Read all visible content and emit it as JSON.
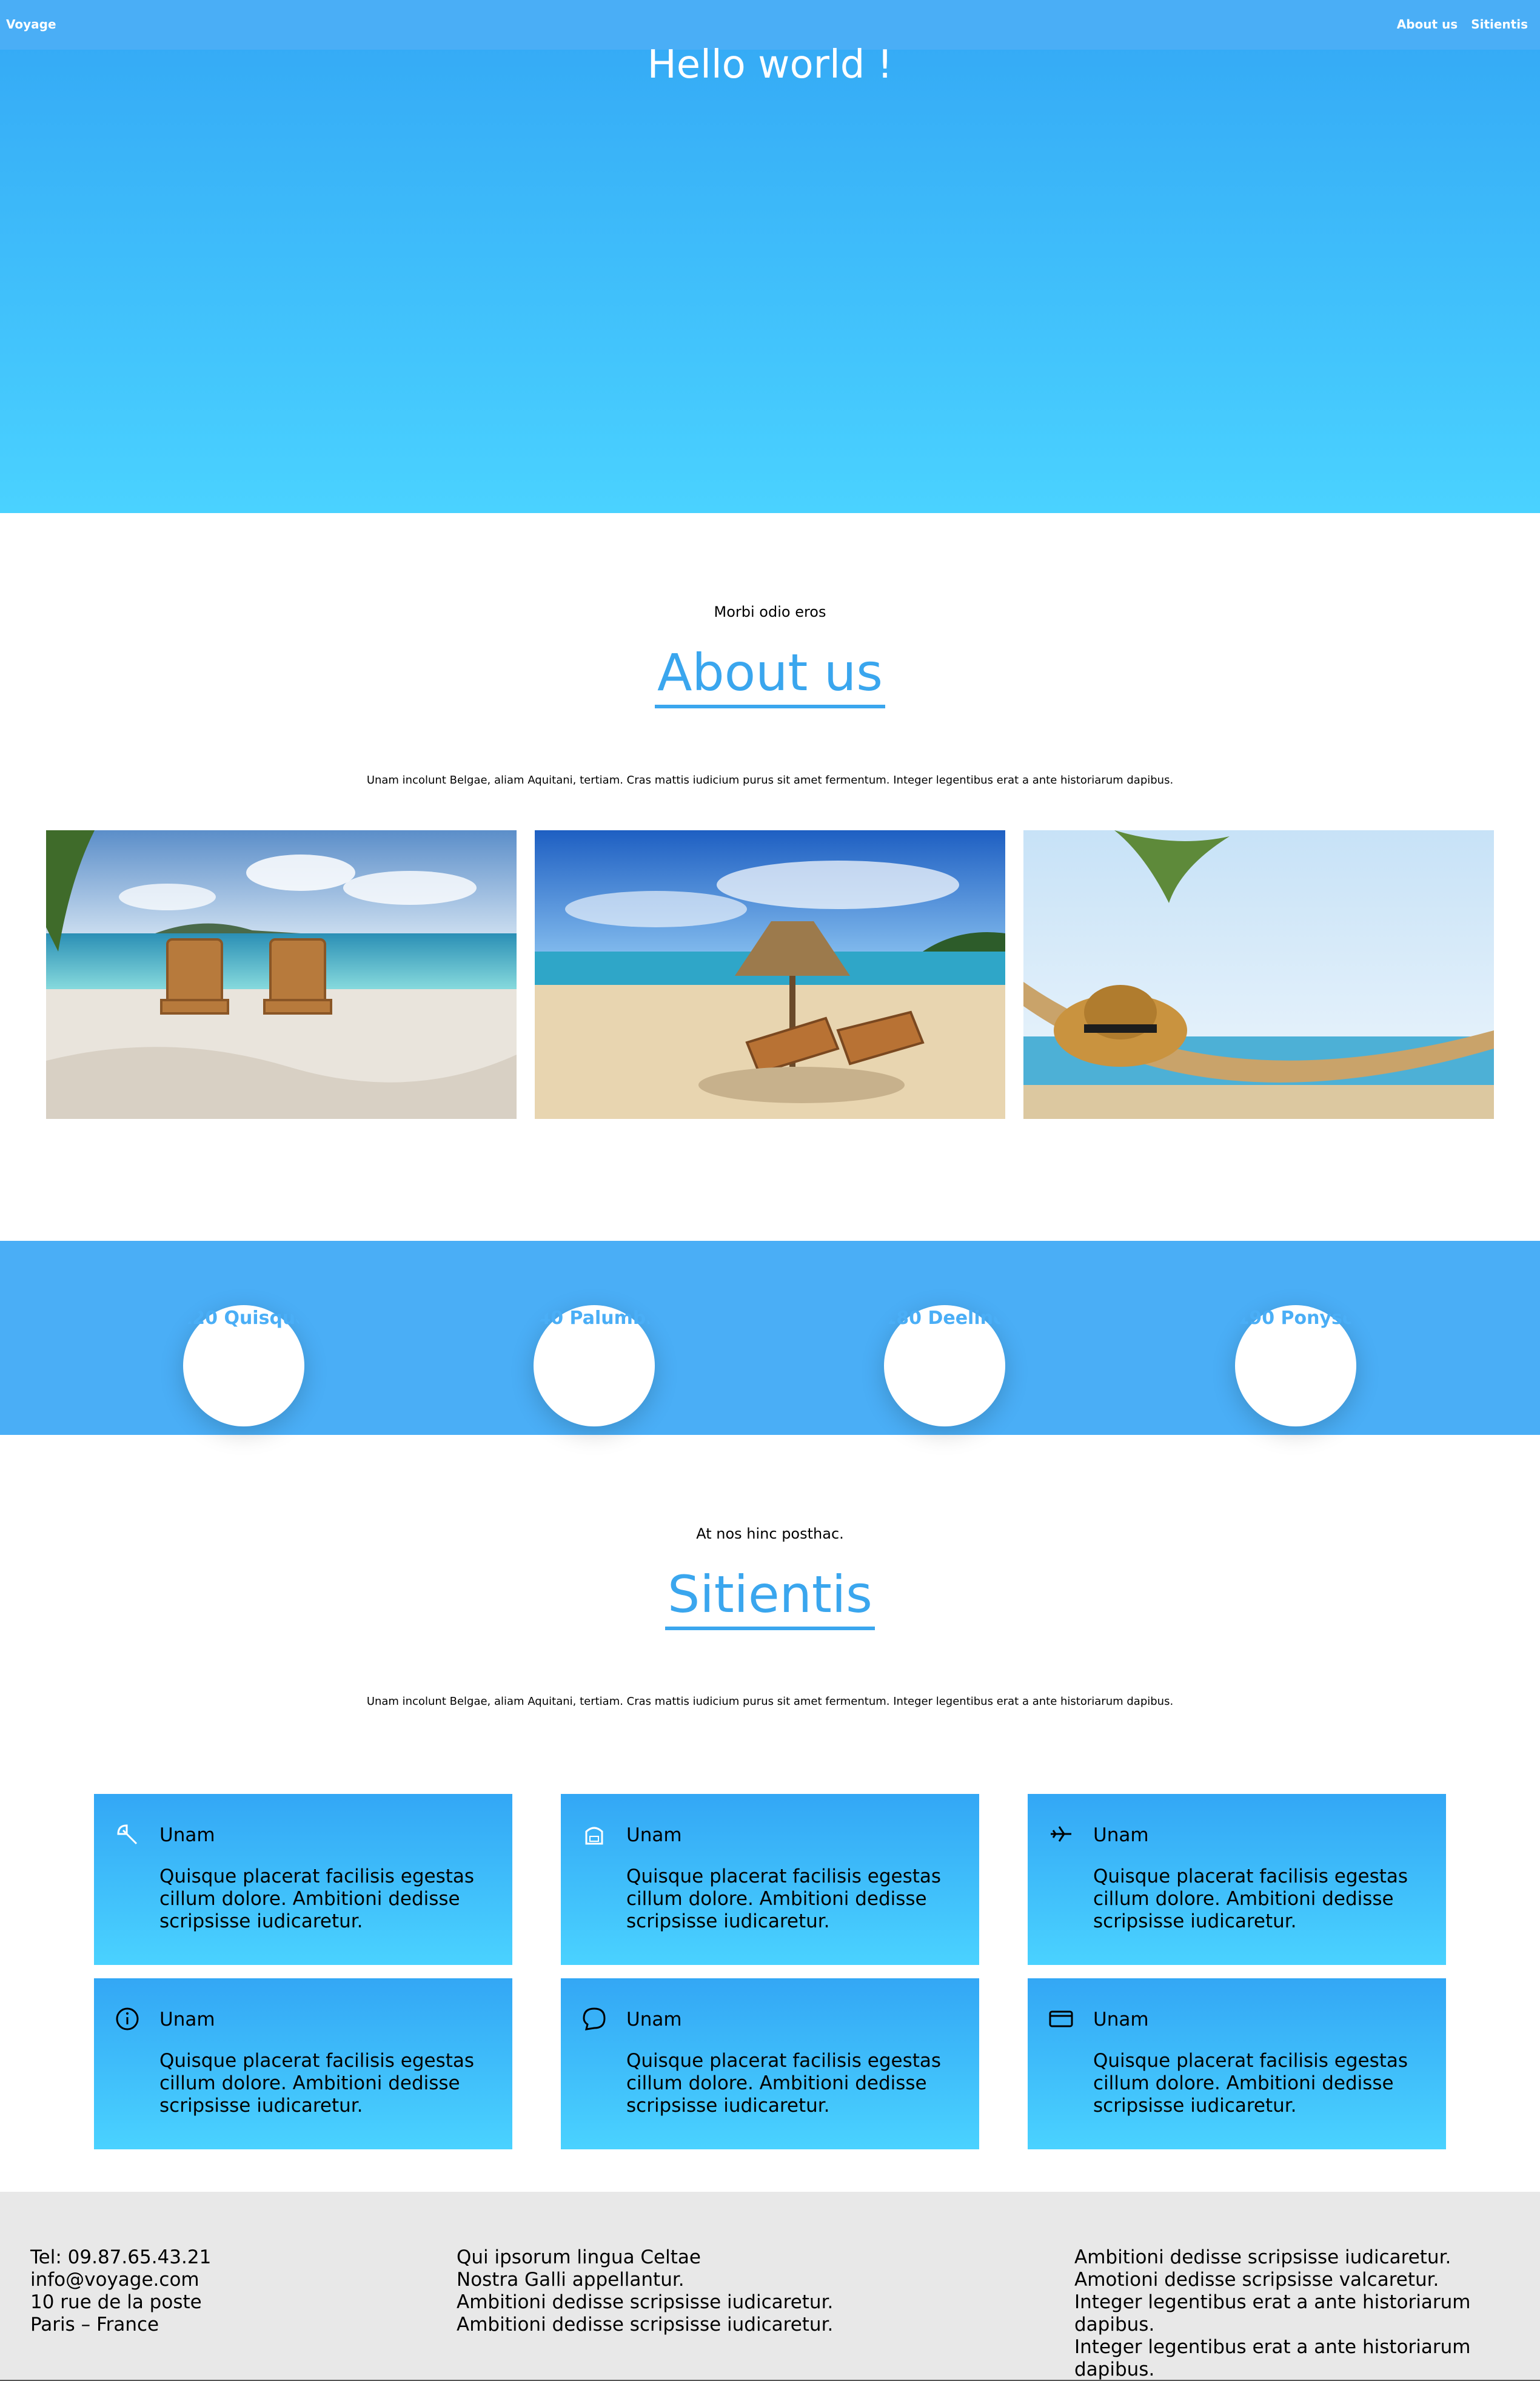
{
  "nav": {
    "brand": "Voyage",
    "links": [
      "About us",
      "Sitientis"
    ]
  },
  "hero": {
    "title": "Hello world !"
  },
  "about": {
    "kicker": "Morbi odio eros",
    "title": "About us",
    "lead": "Unam incolunt Belgae, aliam Aquitani, tertiam. Cras mattis iudicium purus sit amet fermentum. Integer legentibus erat a ante historiarum dapibus."
  },
  "stats": [
    {
      "label": "120 Quisque"
    },
    {
      "label": "140 Palumbis"
    },
    {
      "label": "180 Deelino"
    },
    {
      "label": "190 Ponyso"
    }
  ],
  "services": {
    "kicker": "At nos hinc posthac.",
    "title": "Sitientis",
    "lead": "Unam incolunt Belgae, aliam Aquitani, tertiam. Cras mattis iudicium purus sit amet fermentum. Integer legentibus erat a ante historiarum dapibus.",
    "cards": [
      {
        "icon": "beach-umbrella-icon",
        "title": "Unam",
        "text": "Quisque placerat facilisis egestas cillum dolore. Ambitioni dedisse scripsisse iudicaretur."
      },
      {
        "icon": "hotel-icon",
        "title": "Unam",
        "text": "Quisque placerat facilisis egestas cillum dolore. Ambitioni dedisse scripsisse iudicaretur."
      },
      {
        "icon": "airplane-icon",
        "title": "Unam",
        "text": "Quisque placerat facilisis egestas cillum dolore. Ambitioni dedisse scripsisse iudicaretur."
      },
      {
        "icon": "info-icon",
        "title": "Unam",
        "text": "Quisque placerat facilisis egestas cillum dolore. Ambitioni dedisse scripsisse iudicaretur."
      },
      {
        "icon": "chat-bubble-icon",
        "title": "Unam",
        "text": "Quisque placerat facilisis egestas cillum dolore. Ambitioni dedisse scripsisse iudicaretur."
      },
      {
        "icon": "credit-card-icon",
        "title": "Unam",
        "text": "Quisque placerat facilisis egestas cillum dolore. Ambitioni dedisse scripsisse iudicaretur."
      }
    ]
  },
  "footer": {
    "contact": [
      "Tel: 09.87.65.43.21",
      "info@voyage.com",
      "10 rue de la poste",
      "Paris – France"
    ],
    "middle": [
      "Qui ipsorum lingua Celtae",
      "Nostra Galli appellantur.",
      "Ambitioni dedisse scripsisse iudicaretur.",
      "Ambitioni dedisse scripsisse iudicaretur."
    ],
    "right": [
      "Ambitioni dedisse scripsisse iudicaretur.",
      "Amotioni dedisse scripsisse valcaretur.",
      "Integer legentibus erat a ante historiarum dapibus.",
      "Integer legentibus erat a ante historiarum dapibus."
    ]
  },
  "colors": {
    "accent": "#3aa6ee",
    "nav": "#4aaef6",
    "footer_bg": "#e8e8e8"
  }
}
